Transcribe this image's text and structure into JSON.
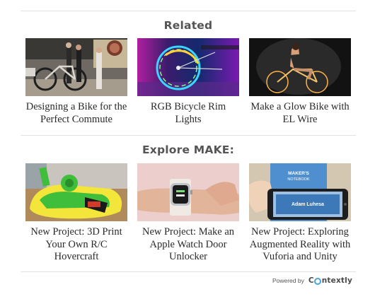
{
  "related": {
    "title": "Related",
    "items": [
      {
        "caption": "Designing a Bike for the Perfect Commute",
        "thumb": "bike-commute-photo"
      },
      {
        "caption": "RGB Bicycle Rim Lights",
        "thumb": "rgb-rim-lights-photo"
      },
      {
        "caption": "Make a Glow Bike with EL Wire",
        "thumb": "glow-bike-photo"
      }
    ]
  },
  "explore": {
    "title": "Explore MAKE:",
    "items": [
      {
        "caption": "New Project: 3D Print Your Own R/C Hovercraft",
        "thumb": "hovercraft-photo"
      },
      {
        "caption": "New Project: Make an Apple Watch Door Unlocker",
        "thumb": "apple-watch-photo"
      },
      {
        "caption": "New Project: Exploring Augmented Reality with Vuforia and Unity",
        "thumb": "ar-phone-photo",
        "thumb_text": [
          "MAKER'S",
          "NOTEBOOK",
          "Adam Luhesa"
        ]
      }
    ]
  },
  "footer": {
    "powered_label": "Powered by",
    "brand_prefix": "C",
    "brand_suffix": "ntextly"
  },
  "colors": {
    "divider": "#e1e1e1",
    "heading": "#555555",
    "brand_accent": "#4ca3d8"
  }
}
